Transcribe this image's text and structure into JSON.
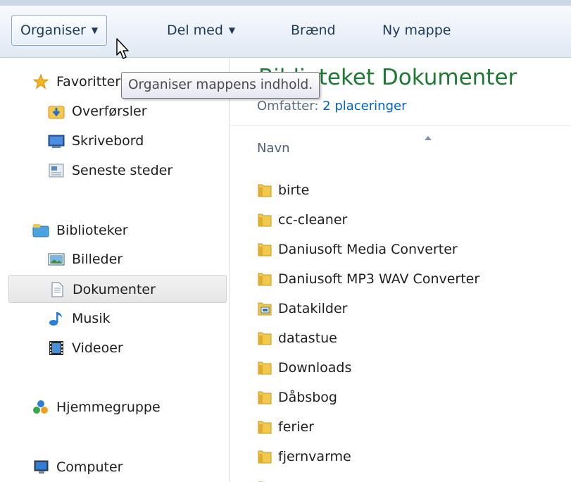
{
  "toolbar": {
    "organise_label": "Organiser",
    "share_label": "Del med",
    "burn_label": "Brænd",
    "new_folder_label": "Ny mappe"
  },
  "tooltip": {
    "text": "Organiser mappens indhold."
  },
  "nav": {
    "favorites": {
      "label": "Favoritter",
      "items": [
        {
          "label": "Overførsler",
          "icon": "downloads-icon"
        },
        {
          "label": "Skrivebord",
          "icon": "desktop-icon"
        },
        {
          "label": "Seneste steder",
          "icon": "recent-places-icon"
        }
      ]
    },
    "libraries": {
      "label": "Biblioteker",
      "items": [
        {
          "label": "Billeder",
          "icon": "pictures-icon"
        },
        {
          "label": "Dokumenter",
          "icon": "documents-icon",
          "selected": true
        },
        {
          "label": "Musik",
          "icon": "music-icon"
        },
        {
          "label": "Videoer",
          "icon": "videos-icon"
        }
      ]
    },
    "homegroup": {
      "label": "Hjemmegruppe",
      "icon": "homegroup-icon"
    },
    "computer": {
      "label": "Computer",
      "icon": "computer-icon"
    }
  },
  "content": {
    "title": "Biblioteket Dokumenter",
    "includes_label": "Omfatter:",
    "includes_link": "2 placeringer",
    "column_name": "Navn",
    "files": [
      {
        "name": "birte",
        "icon": "folder-icon"
      },
      {
        "name": "cc-cleaner",
        "icon": "folder-icon"
      },
      {
        "name": "Daniusoft Media Converter",
        "icon": "folder-icon"
      },
      {
        "name": "Daniusoft MP3 WAV Converter",
        "icon": "folder-icon"
      },
      {
        "name": "Datakilder",
        "icon": "data-sources-folder-icon"
      },
      {
        "name": "datastue",
        "icon": "folder-icon"
      },
      {
        "name": "Downloads",
        "icon": "folder-icon"
      },
      {
        "name": "Dåbsbog",
        "icon": "folder-icon"
      },
      {
        "name": "ferier",
        "icon": "folder-icon"
      },
      {
        "name": "fjernvarme",
        "icon": "folder-icon"
      }
    ]
  },
  "colors": {
    "title_green": "#1e7a33",
    "link_blue": "#0066cc",
    "toolbar_text": "#1e395b",
    "folder_yellow": "#f2c94c"
  }
}
